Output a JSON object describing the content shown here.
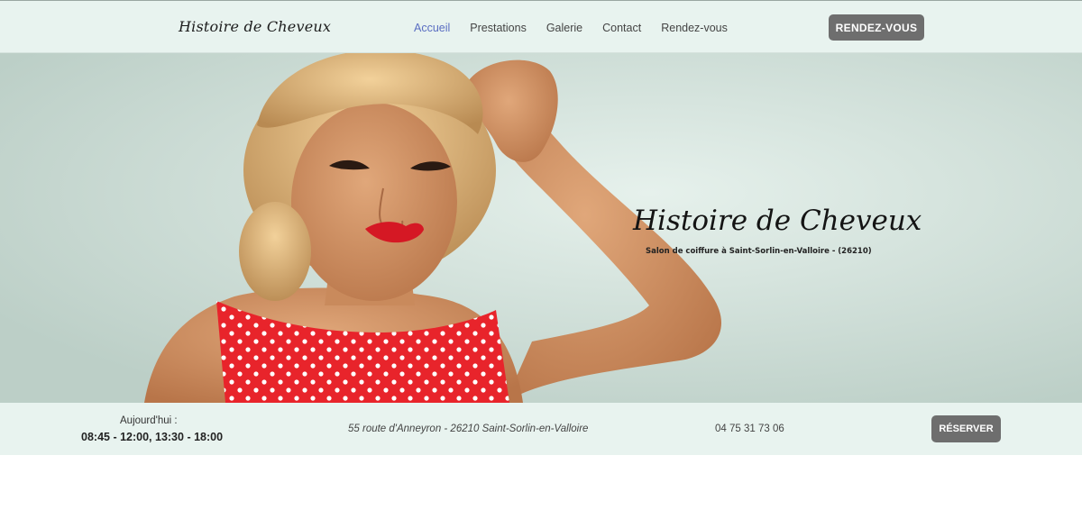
{
  "header": {
    "logo": "Histoire de Cheveux",
    "nav": [
      "Accueil",
      "Prestations",
      "Galerie",
      "Contact",
      "Rendez-vous"
    ],
    "active_nav": "Accueil",
    "cta_label": "RENDEZ-VOUS"
  },
  "hero": {
    "title": "Histoire de Cheveux",
    "subtitle": "Salon de coiffure à Saint-Sorlin-en-Valloire - (26210)"
  },
  "infobar": {
    "hours_label": "Aujourd'hui :",
    "hours_value": "08:45 - 12:00, 13:30 - 18:00",
    "address": "55 route d'Anneyron - 26210 Saint-Sorlin-en-Valloire",
    "phone": "04 75 31 73 06",
    "reserve_label": "RÉSERVER"
  },
  "colors": {
    "header_bg": "#e8f3ef",
    "button_bg": "#6e6e6e",
    "active_link": "#5a6ec2",
    "dress_red": "#e8242b"
  },
  "icons": [
    "hero-photo-woman"
  ]
}
